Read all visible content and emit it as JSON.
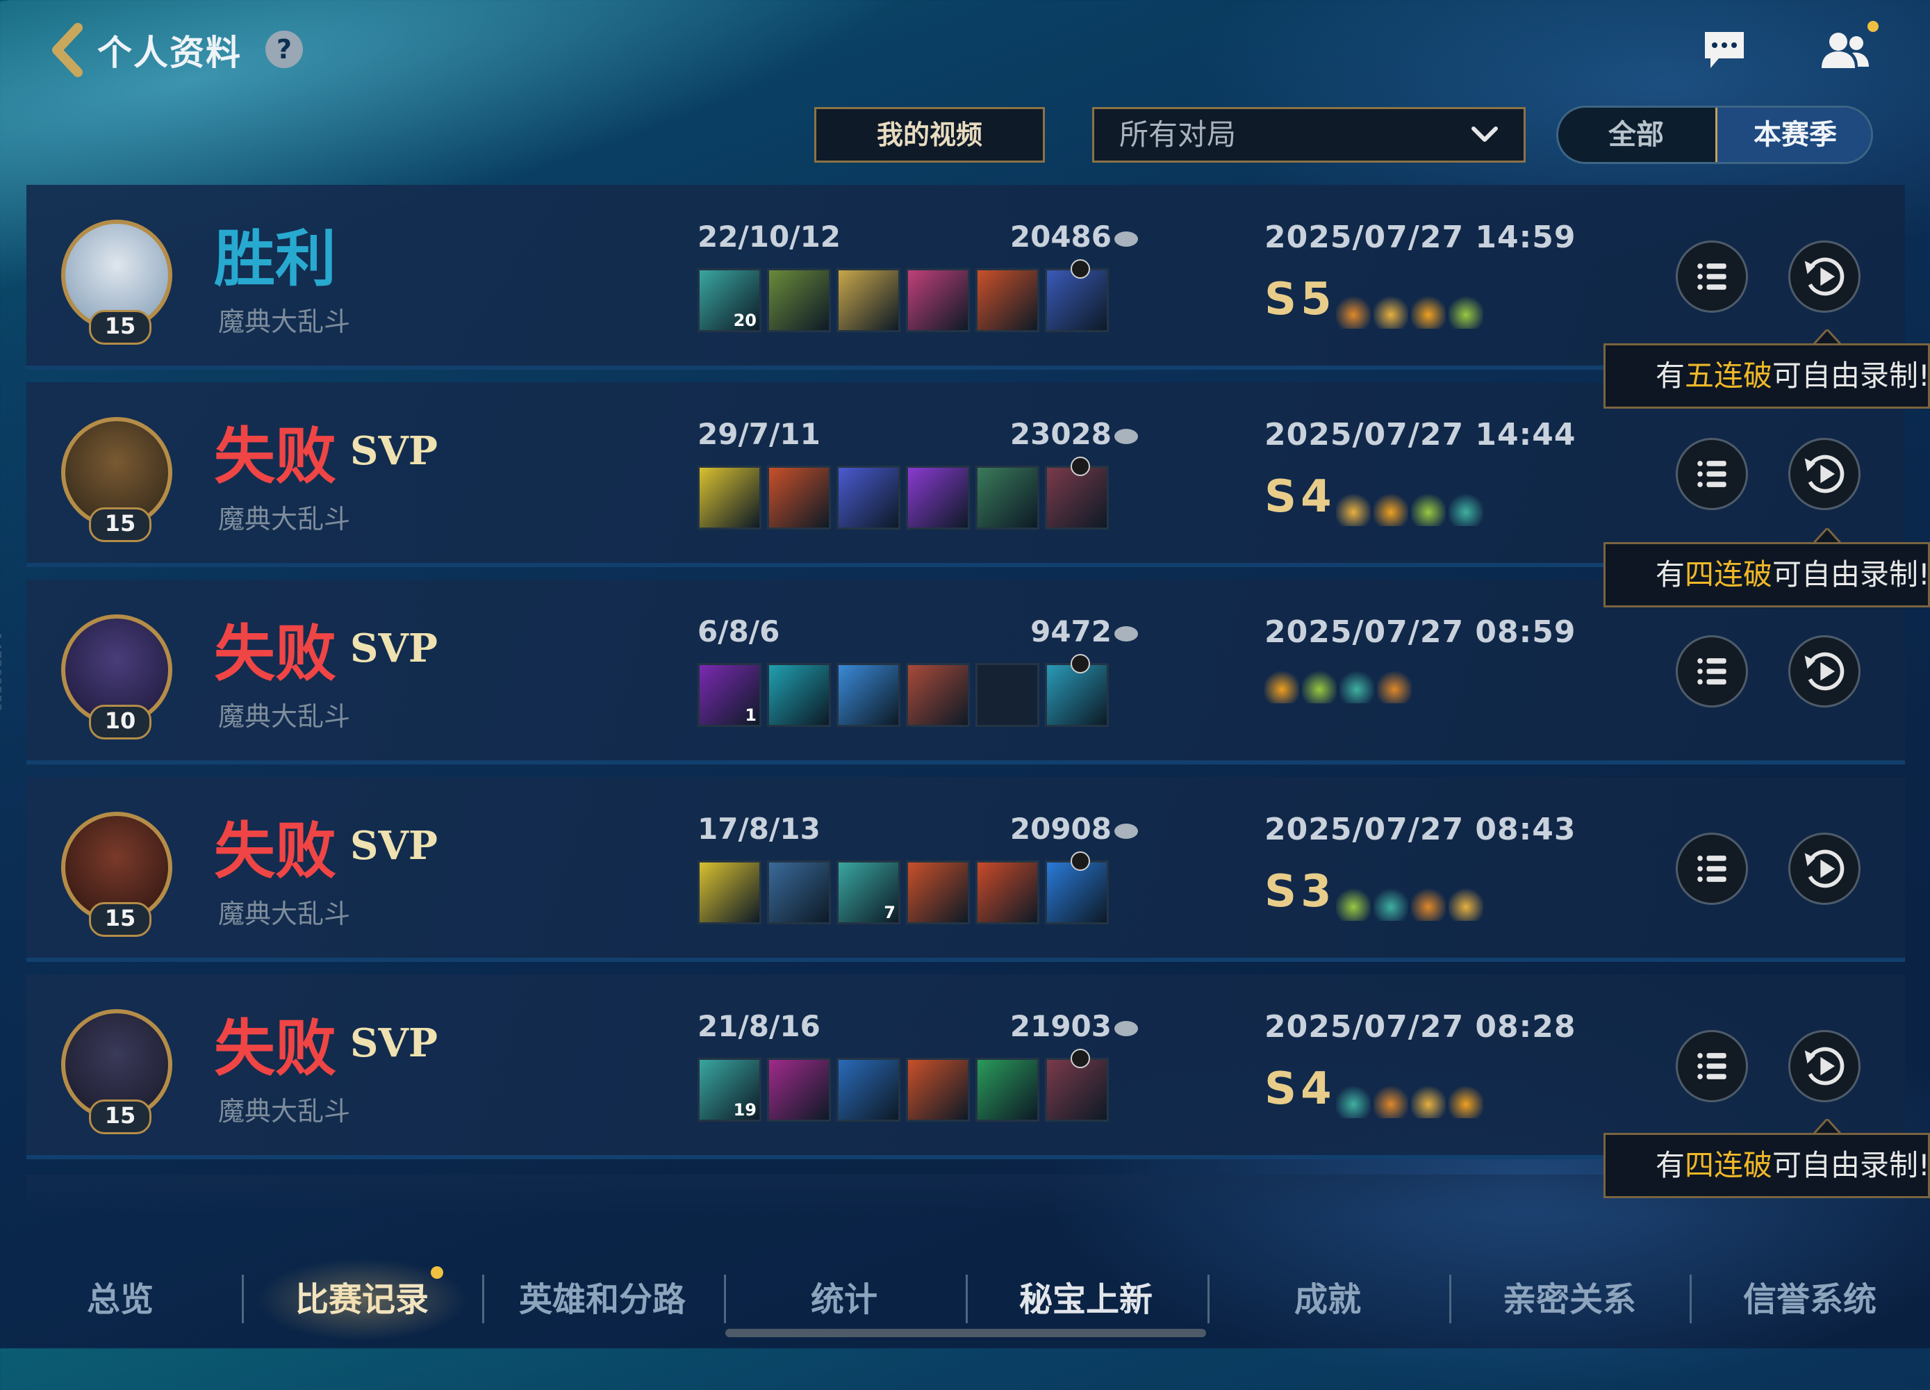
{
  "header": {
    "title": "个人资料",
    "help_icon": "?"
  },
  "controls": {
    "my_videos_label": "我的视频",
    "filter_value": "所有对局",
    "toggle": {
      "all_label": "全部",
      "season_label": "本赛季",
      "selected": "本赛季"
    }
  },
  "matches": [
    {
      "result": "胜利",
      "svp": "",
      "level": "15",
      "mode": "魔典大乱斗",
      "kda": "22/10/12",
      "gold": "20486",
      "datetime": "2025/07/27 14:59",
      "streak_letter": "S",
      "streak_num": "5",
      "items": [
        "cannon-item",
        "blade-item",
        "sword-item",
        "pink-blade-item",
        "fire-blade-item",
        "hourglass-item"
      ],
      "item_counts": [
        "20",
        "",
        "",
        "",
        "",
        ""
      ]
    },
    {
      "result": "失败",
      "svp": "SVP",
      "level": "15",
      "mode": "魔典大乱斗",
      "kda": "29/7/11",
      "gold": "23028",
      "datetime": "2025/07/27 14:44",
      "streak_letter": "S",
      "streak_num": "4",
      "items": [
        "triangle-item",
        "fire-blade-item",
        "trident-item",
        "scythe-item",
        "armor-item",
        "chain-item"
      ],
      "item_counts": [
        "",
        "",
        "",
        "",
        "",
        ""
      ]
    },
    {
      "result": "失败",
      "svp": "SVP",
      "level": "10",
      "mode": "魔典大乱斗",
      "kda": "6/8/6",
      "gold": "9472",
      "datetime": "2025/07/27 08:59",
      "streak_letter": "",
      "streak_num": "",
      "items": [
        "purple-staff-item",
        "spirit-item",
        "ice-sword-item",
        "book-item",
        "empty",
        "cyan-boots-item"
      ],
      "item_counts": [
        "1",
        "",
        "",
        "",
        "",
        ""
      ]
    },
    {
      "result": "失败",
      "svp": "SVP",
      "level": "15",
      "mode": "魔典大乱斗",
      "kda": "17/8/13",
      "gold": "20908",
      "datetime": "2025/07/27 08:43",
      "streak_letter": "S",
      "streak_num": "3",
      "items": [
        "triangle-item",
        "helm-item",
        "cannon-item",
        "fire-blade-item",
        "flame-armor-item",
        "gauntlet-item"
      ],
      "item_counts": [
        "",
        "",
        "7",
        "",
        "",
        ""
      ]
    },
    {
      "result": "失败",
      "svp": "SVP",
      "level": "15",
      "mode": "魔典大乱斗",
      "kda": "21/8/16",
      "gold": "21903",
      "datetime": "2025/07/27 08:28",
      "streak_letter": "S",
      "streak_num": "4",
      "items": [
        "cannon-item",
        "fang-item",
        "blue-sword-item",
        "fire-blade-item",
        "green-sword-item",
        "chain-item"
      ],
      "item_counts": [
        "19",
        "",
        "",
        "",
        "",
        ""
      ]
    }
  ],
  "tooltips": [
    {
      "prefix": "有",
      "highlight": "五连破",
      "suffix": "可自由录制!"
    },
    {
      "prefix": "有",
      "highlight": "四连破",
      "suffix": "可自由录制!"
    },
    {
      "prefix": "有",
      "highlight": "四连破",
      "suffix": "可自由录制!"
    }
  ],
  "nav": {
    "tabs": [
      "总览",
      "比赛记录",
      "英雄和分路",
      "统计",
      "秘宝上新",
      "成就",
      "亲密关系",
      "信誉系统"
    ],
    "active": "比赛记录"
  },
  "side_id": "147309553",
  "colors": {
    "win": "#28a9d0",
    "lose": "#f04545",
    "gold_accent": "#c4a25a",
    "highlight": "#f0b828"
  }
}
